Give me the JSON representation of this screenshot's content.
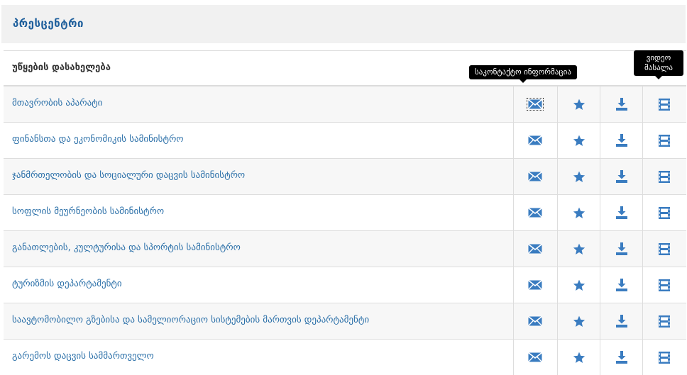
{
  "page": {
    "title": "პრესცენტრი"
  },
  "table": {
    "header_label": "უწყების დასახელება",
    "rows": [
      {
        "name": "მთავრობის აპარატი"
      },
      {
        "name": "ფინანსთა და ეკონომიკის სამინისტრო"
      },
      {
        "name": "ჯანმრთელობის და სოციალური დაცვის სამინისტრო"
      },
      {
        "name": "სოფლის მეურნეობის სამინისტრო"
      },
      {
        "name": "განათლების, კულტურისა და სპორტის სამინისტრო"
      },
      {
        "name": "ტურიზმის დეპარტამენტი"
      },
      {
        "name": "საავტომობილო გზებისა და სამელიორაციო სისტემების მართვის დეპარტამენტი"
      },
      {
        "name": "გარემოს დაცვის სამმართველო"
      }
    ]
  },
  "tooltips": {
    "contact": "საკონტაქტო ინფორმაცია",
    "video": "ვიდეო მასალა"
  },
  "icons": {
    "contact": "envelope-icon",
    "favorite": "star-icon",
    "download": "download-icon",
    "video": "film-icon"
  },
  "colors": {
    "title": "#1e5f9c",
    "link": "#2a6fa8",
    "icon": "#3a7cc0",
    "header_bg": "#f1f1f1",
    "tooltip_bg": "#000000"
  }
}
